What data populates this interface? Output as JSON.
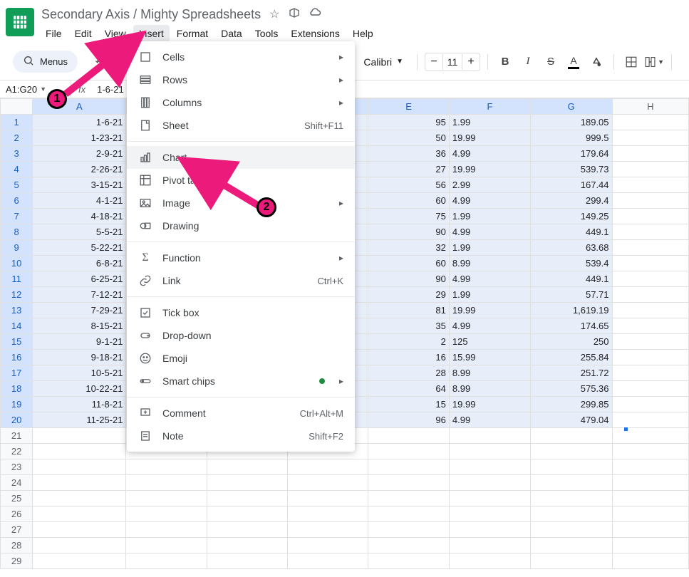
{
  "doc_title": "Secondary Axis / Mighty Spreadsheets",
  "menus_label": "Menus",
  "menubar": [
    "File",
    "Edit",
    "View",
    "Insert",
    "Format",
    "Data",
    "Tools",
    "Extensions",
    "Help"
  ],
  "active_menu_index": 3,
  "name_box": "A1:G20",
  "fx": "fx",
  "formula_value": "1-6-21",
  "font_name": "Calibri",
  "font_size": "11",
  "columns": [
    "A",
    "B",
    "C",
    "D",
    "E",
    "F",
    "G",
    "H"
  ],
  "col_widths": [
    "col-A",
    "col-B",
    "col-C",
    "col-D",
    "col-E",
    "col-F",
    "col-G",
    "col-H"
  ],
  "row_count": 29,
  "selected_cols": [
    "A",
    "B",
    "C",
    "D",
    "E",
    "F",
    "G"
  ],
  "selected_rows": 20,
  "rows": [
    {
      "A": "1-6-21",
      "E": "95",
      "F": "1.99",
      "G": "189.05"
    },
    {
      "A": "1-23-21",
      "E": "50",
      "F": "19.99",
      "G": "999.5"
    },
    {
      "A": "2-9-21",
      "E": "36",
      "F": "4.99",
      "G": "179.64"
    },
    {
      "A": "2-26-21",
      "E": "27",
      "F": "19.99",
      "G": "539.73"
    },
    {
      "A": "3-15-21",
      "E": "56",
      "F": "2.99",
      "G": "167.44"
    },
    {
      "A": "4-1-21",
      "E": "60",
      "F": "4.99",
      "G": "299.4"
    },
    {
      "A": "4-18-21",
      "E": "75",
      "F": "1.99",
      "G": "149.25"
    },
    {
      "A": "5-5-21",
      "E": "90",
      "F": "4.99",
      "G": "449.1"
    },
    {
      "A": "5-22-21",
      "E": "32",
      "F": "1.99",
      "G": "63.68"
    },
    {
      "A": "6-8-21",
      "E": "60",
      "F": "8.99",
      "G": "539.4"
    },
    {
      "A": "6-25-21",
      "E": "90",
      "F": "4.99",
      "G": "449.1"
    },
    {
      "A": "7-12-21",
      "E": "29",
      "F": "1.99",
      "G": "57.71"
    },
    {
      "A": "7-29-21",
      "E": "81",
      "F": "19.99",
      "G": "1,619.19"
    },
    {
      "A": "8-15-21",
      "E": "35",
      "F": "4.99",
      "G": "174.65"
    },
    {
      "A": "9-1-21",
      "E": "2",
      "F": "125",
      "G": "250"
    },
    {
      "A": "9-18-21",
      "E": "16",
      "F": "15.99",
      "G": "255.84"
    },
    {
      "A": "10-5-21",
      "E": "28",
      "F": "8.99",
      "G": "251.72"
    },
    {
      "A": "10-22-21",
      "E": "64",
      "F": "8.99",
      "G": "575.36"
    },
    {
      "A": "11-8-21",
      "E": "15",
      "F": "19.99",
      "G": "299.85"
    },
    {
      "A": "11-25-21",
      "E": "96",
      "F": "4.99",
      "G": "479.04"
    }
  ],
  "dropdown": [
    {
      "type": "item",
      "label": "Cells",
      "icon": "cells",
      "arrow": true
    },
    {
      "type": "item",
      "label": "Rows",
      "icon": "rows",
      "arrow": true
    },
    {
      "type": "item",
      "label": "Columns",
      "icon": "columns",
      "arrow": true
    },
    {
      "type": "item",
      "label": "Sheet",
      "icon": "sheet",
      "shortcut": "Shift+F11"
    },
    {
      "type": "sep"
    },
    {
      "type": "item",
      "label": "Chart",
      "icon": "chart",
      "hover": true
    },
    {
      "type": "item",
      "label": "Pivot table",
      "icon": "pivot"
    },
    {
      "type": "item",
      "label": "Image",
      "icon": "image",
      "arrow": true
    },
    {
      "type": "item",
      "label": "Drawing",
      "icon": "drawing"
    },
    {
      "type": "sep"
    },
    {
      "type": "item",
      "label": "Function",
      "icon": "function",
      "arrow": true
    },
    {
      "type": "item",
      "label": "Link",
      "icon": "link",
      "shortcut": "Ctrl+K"
    },
    {
      "type": "sep"
    },
    {
      "type": "item",
      "label": "Tick box",
      "icon": "tickbox"
    },
    {
      "type": "item",
      "label": "Drop-down",
      "icon": "dropdown"
    },
    {
      "type": "item",
      "label": "Emoji",
      "icon": "emoji"
    },
    {
      "type": "item",
      "label": "Smart chips",
      "icon": "chips",
      "dot": true,
      "arrow": true
    },
    {
      "type": "sep"
    },
    {
      "type": "item",
      "label": "Comment",
      "icon": "comment",
      "shortcut": "Ctrl+Alt+M"
    },
    {
      "type": "item",
      "label": "Note",
      "icon": "note",
      "shortcut": "Shift+F2"
    }
  ],
  "anno": {
    "label1": "1",
    "label2": "2"
  }
}
